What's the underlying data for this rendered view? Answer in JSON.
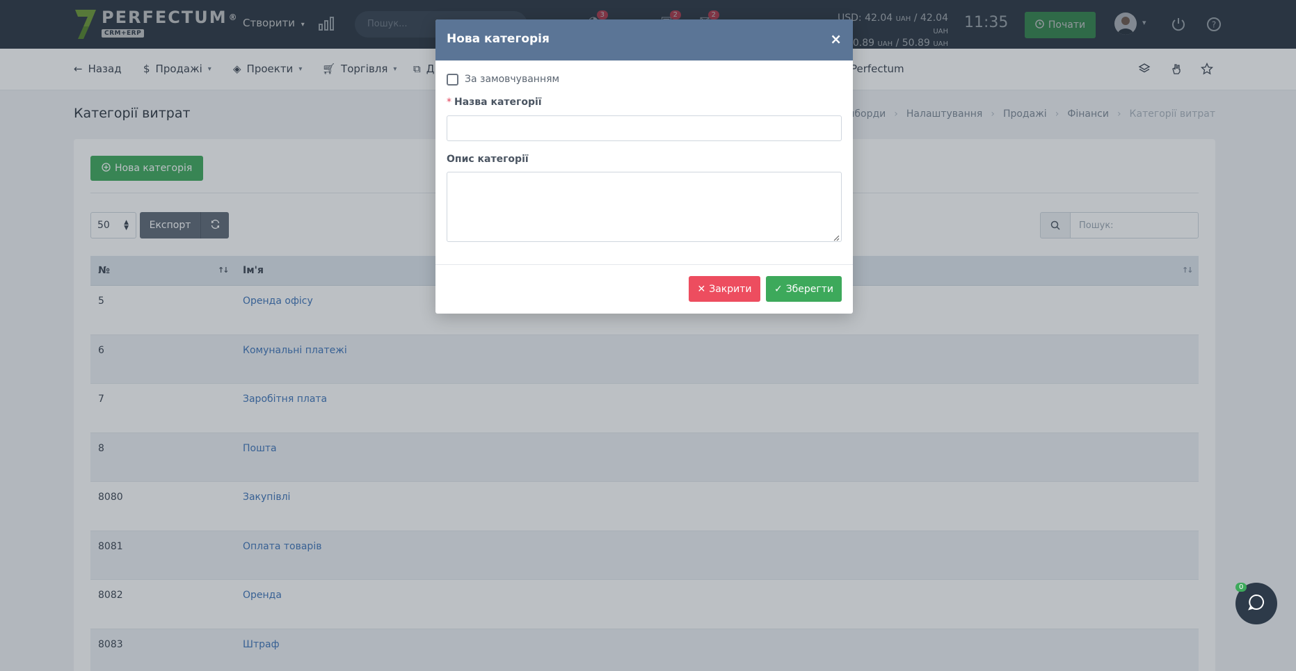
{
  "topbar": {
    "logo_text": "PERFECTUM",
    "logo_registered": "®",
    "logo_sub": "CRM+ERP",
    "create_label": "Створити",
    "search_placeholder": "Пошук...",
    "badges": [
      "3",
      "2",
      "2"
    ],
    "rates": {
      "line1_prefix": "USD: 42.04",
      "line1_u1": "UAH",
      "line1_mid": " / 42.04 ",
      "line1_u2": "UAH",
      "line2_prefix": "50.89 ",
      "line2_u1": "UAH",
      "line2_mid": " / 50.89 ",
      "line2_u2": "UAH"
    },
    "clock": "11:35",
    "start_label": "Почати"
  },
  "subnav": {
    "back": "Назад",
    "sales": "Продажі",
    "projects": "Проекти",
    "trade": "Торгівля",
    "docs_partial": "Д",
    "perfectum_partial": "Perfectum"
  },
  "page": {
    "title": "Категорії витрат",
    "breadcrumb": [
      "Дашборди",
      "Налаштування",
      "Продажі",
      "Фінанси",
      "Категорії витрат"
    ]
  },
  "card": {
    "new_category_label": "Нова категорія",
    "page_size": "50",
    "export_label": "Експорт",
    "search_placeholder": "Пошук:"
  },
  "table": {
    "columns": [
      "№",
      "Ім'я"
    ],
    "rows": [
      {
        "id": "5",
        "name": "Оренда офісу"
      },
      {
        "id": "6",
        "name": "Комунальні платежі"
      },
      {
        "id": "7",
        "name": "Заробітня плата"
      },
      {
        "id": "8",
        "name": "Пошта"
      },
      {
        "id": "8080",
        "name": "Закупівлі"
      },
      {
        "id": "8081",
        "name": "Оплата товарів"
      },
      {
        "id": "8082",
        "name": "Оренда"
      },
      {
        "id": "8083",
        "name": "Штраф"
      }
    ]
  },
  "chat": {
    "badge": "0"
  },
  "modal": {
    "title": "Нова категорія",
    "close_symbol": "×",
    "default_label": "За замовчуванням",
    "name_required_mark": "*",
    "name_label": "Назва категорії",
    "name_value": "",
    "desc_label": "Опис категорії",
    "desc_value": "",
    "close_btn": "Закрити",
    "save_btn": "Зберегти"
  },
  "colors": {
    "topbar": "#34404f",
    "modal_header": "#5b7596",
    "green": "#3da95b",
    "red": "#ed4d5f",
    "link": "#3d73b8"
  }
}
